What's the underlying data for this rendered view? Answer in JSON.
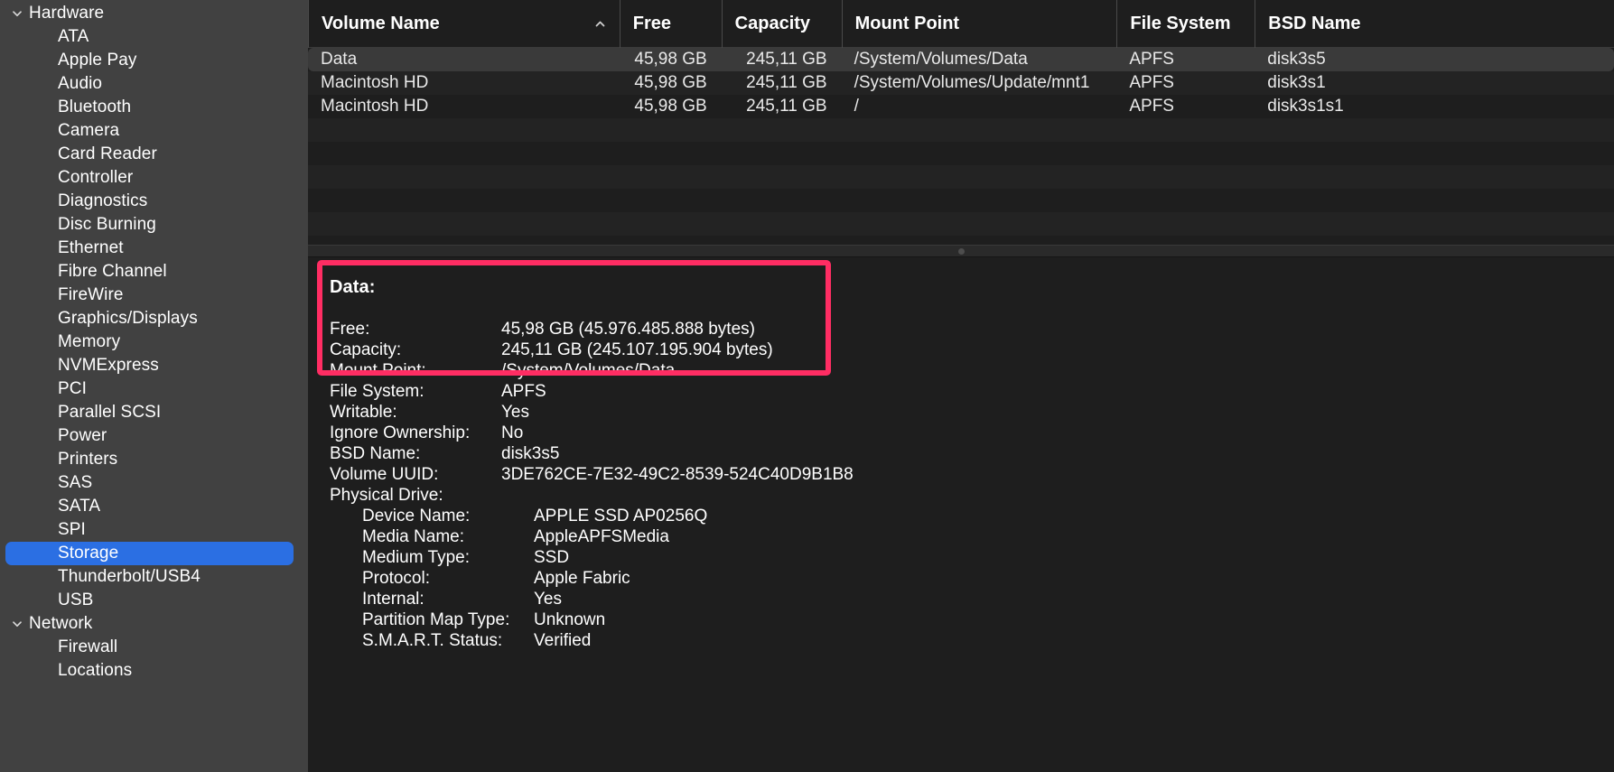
{
  "sidebar": {
    "groups": [
      {
        "label": "Hardware",
        "chevron_icon": "chevron-down-icon",
        "items": [
          {
            "label": "ATA"
          },
          {
            "label": "Apple Pay"
          },
          {
            "label": "Audio"
          },
          {
            "label": "Bluetooth"
          },
          {
            "label": "Camera"
          },
          {
            "label": "Card Reader"
          },
          {
            "label": "Controller"
          },
          {
            "label": "Diagnostics"
          },
          {
            "label": "Disc Burning"
          },
          {
            "label": "Ethernet"
          },
          {
            "label": "Fibre Channel"
          },
          {
            "label": "FireWire"
          },
          {
            "label": "Graphics/Displays"
          },
          {
            "label": "Memory"
          },
          {
            "label": "NVMExpress"
          },
          {
            "label": "PCI"
          },
          {
            "label": "Parallel SCSI"
          },
          {
            "label": "Power"
          },
          {
            "label": "Printers"
          },
          {
            "label": "SAS"
          },
          {
            "label": "SATA"
          },
          {
            "label": "SPI"
          },
          {
            "label": "Storage",
            "selected": true
          },
          {
            "label": "Thunderbolt/USB4"
          },
          {
            "label": "USB"
          }
        ]
      },
      {
        "label": "Network",
        "chevron_icon": "chevron-down-icon",
        "items": [
          {
            "label": "Firewall"
          },
          {
            "label": "Locations"
          }
        ]
      }
    ],
    "selected_item": "Storage",
    "selection_color": "#2b6fe3",
    "background_color": "#414141"
  },
  "table": {
    "sort_column": "Volume Name",
    "sort_direction": "ascending",
    "sort_icon": "chevron-up-icon",
    "columns": [
      {
        "key": "volume_name",
        "label": "Volume Name"
      },
      {
        "key": "free",
        "label": "Free"
      },
      {
        "key": "capacity",
        "label": "Capacity"
      },
      {
        "key": "mount_point",
        "label": "Mount Point"
      },
      {
        "key": "file_system",
        "label": "File System"
      },
      {
        "key": "bsd_name",
        "label": "BSD Name"
      }
    ],
    "rows": [
      {
        "volume_name": "Data",
        "free": "45,98 GB",
        "capacity": "245,11 GB",
        "mount_point": "/System/Volumes/Data",
        "file_system": "APFS",
        "bsd_name": "disk3s5",
        "selected": true
      },
      {
        "volume_name": "Macintosh HD",
        "free": "45,98 GB",
        "capacity": "245,11 GB",
        "mount_point": "/System/Volumes/Update/mnt1",
        "file_system": "APFS",
        "bsd_name": "disk3s1",
        "selected": false
      },
      {
        "volume_name": "Macintosh HD",
        "free": "45,98 GB",
        "capacity": "245,11 GB",
        "mount_point": "/",
        "file_system": "APFS",
        "bsd_name": "disk3s1s1",
        "selected": false
      }
    ],
    "empty_row_count": 5
  },
  "splitter": {
    "grip_icon": "drag-handle-dot-icon"
  },
  "detail": {
    "title": "Data:",
    "rows": [
      {
        "label": "Free:",
        "value": "45,98 GB (45.976.485.888 bytes)",
        "level": 1
      },
      {
        "label": "Capacity:",
        "value": "245,11 GB (245.107.195.904 bytes)",
        "level": 1
      },
      {
        "label": "Mount Point:",
        "value": "/System/Volumes/Data",
        "level": 1
      },
      {
        "label": "File System:",
        "value": "APFS",
        "level": 1
      },
      {
        "label": "Writable:",
        "value": "Yes",
        "level": 1
      },
      {
        "label": "Ignore Ownership:",
        "value": "No",
        "level": 1
      },
      {
        "label": "BSD Name:",
        "value": "disk3s5",
        "level": 1
      },
      {
        "label": "Volume UUID:",
        "value": "3DE762CE-7E32-49C2-8539-524C40D9B1B8",
        "level": 1
      },
      {
        "label": "Physical Drive:",
        "value": "",
        "level": 1
      },
      {
        "label": "Device Name:",
        "value": "APPLE SSD AP0256Q",
        "level": 2
      },
      {
        "label": "Media Name:",
        "value": "AppleAPFSMedia",
        "level": 2
      },
      {
        "label": "Medium Type:",
        "value": "SSD",
        "level": 2
      },
      {
        "label": "Protocol:",
        "value": "Apple Fabric",
        "level": 2
      },
      {
        "label": "Internal:",
        "value": "Yes",
        "level": 2
      },
      {
        "label": "Partition Map Type:",
        "value": "Unknown",
        "level": 2
      },
      {
        "label": "S.M.A.R.T. Status:",
        "value": "Verified",
        "level": 2
      }
    ]
  },
  "annotation": {
    "color": "#ff2d63",
    "shape": "rectangle-outline"
  }
}
